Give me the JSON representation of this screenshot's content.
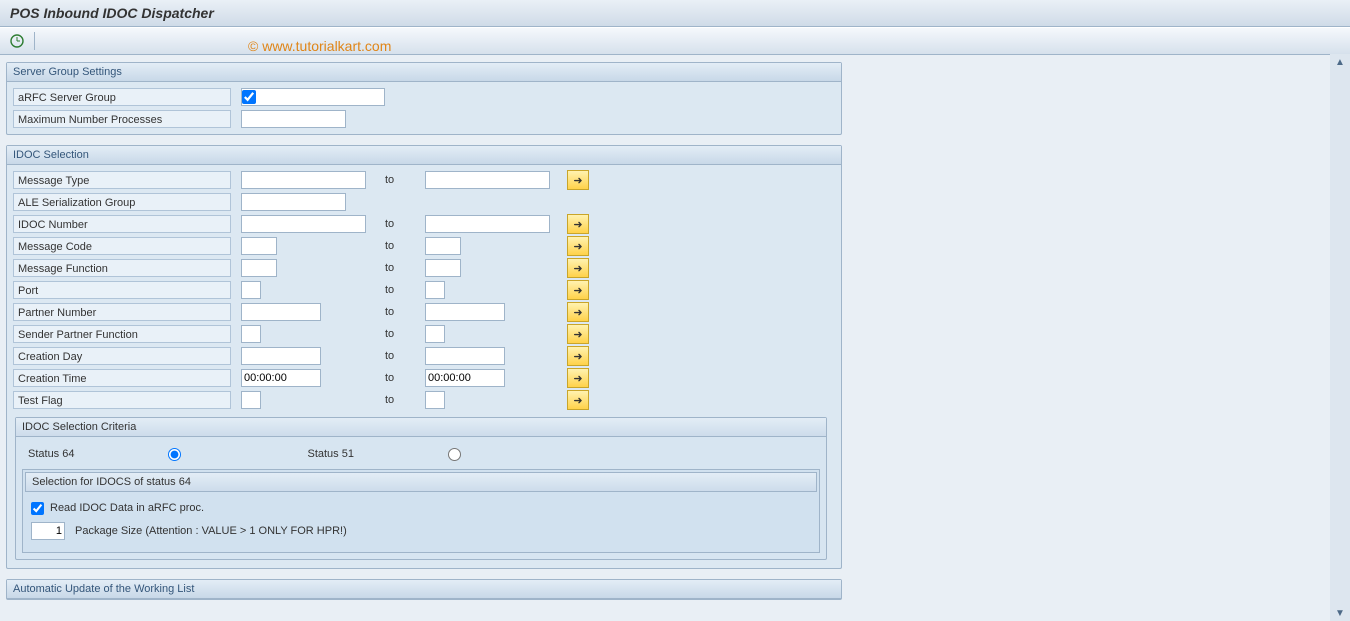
{
  "watermark": "© www.tutorialkart.com",
  "window": {
    "title": "POS Inbound IDOC Dispatcher"
  },
  "common": {
    "to": "to"
  },
  "server_group": {
    "title": "Server Group Settings",
    "arfc_label": "aRFC Server Group",
    "arfc_checked": true,
    "arfc_value": "",
    "max_proc_label": "Maximum Number Processes",
    "max_proc_value": ""
  },
  "idoc": {
    "title": "IDOC Selection",
    "rows": {
      "message_type": {
        "label": "Message Type",
        "from": "",
        "to": ""
      },
      "ale_group": {
        "label": "ALE Serialization Group",
        "from": ""
      },
      "idoc_number": {
        "label": "IDOC Number",
        "from": "",
        "to": ""
      },
      "message_code": {
        "label": "Message Code",
        "from": "",
        "to": ""
      },
      "message_function": {
        "label": "Message Function",
        "from": "",
        "to": ""
      },
      "port": {
        "label": "Port",
        "from": "",
        "to": ""
      },
      "partner_number": {
        "label": "Partner Number",
        "from": "",
        "to": ""
      },
      "sender_partner_function": {
        "label": "Sender Partner Function",
        "from": "",
        "to": ""
      },
      "creation_day": {
        "label": "Creation Day",
        "from": "",
        "to": ""
      },
      "creation_time": {
        "label": "Creation Time",
        "from": "00:00:00",
        "to": "00:00:00"
      },
      "test_flag": {
        "label": "Test Flag",
        "from": "",
        "to": ""
      }
    }
  },
  "criteria": {
    "title": "IDOC Selection Criteria",
    "status64": "Status 64",
    "status51": "Status 51",
    "selected": "64",
    "box_title": "Selection for IDOCS of status 64",
    "read_label": "Read IDOC Data in aRFC proc.",
    "read_checked": true,
    "pkg_value": "1",
    "pkg_label": "Package Size  (Attention : VALUE > 1 ONLY FOR HPR!)"
  },
  "auto_update": {
    "title": "Automatic Update of the Working List"
  }
}
